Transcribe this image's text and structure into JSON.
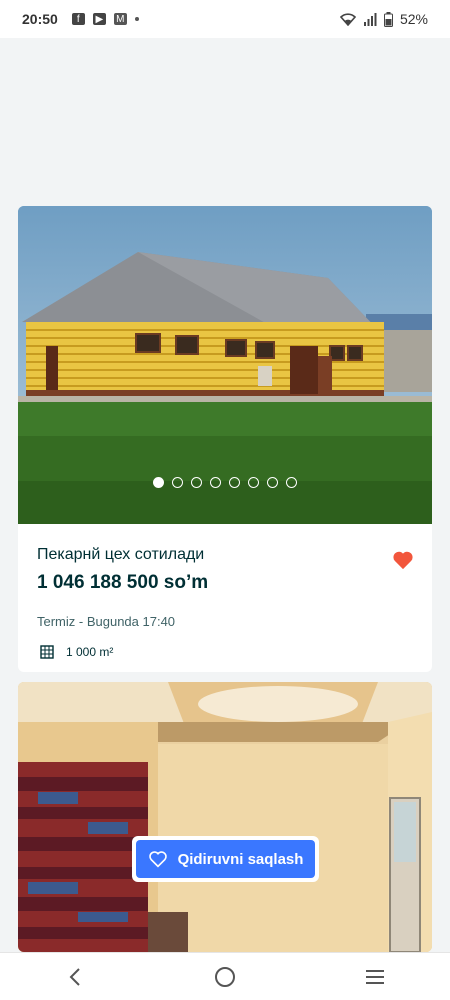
{
  "status_bar": {
    "time": "20:50",
    "battery": "52%",
    "apps": [
      "facebook-icon",
      "youtube-icon",
      "gmail-icon"
    ]
  },
  "listings": [
    {
      "title": "Пекарнй цех сотилади",
      "price": "1 046 188 500 so’m",
      "location": "Termiz - Bugunda 17:40",
      "area": "1 000 m²",
      "favorite": true,
      "photo_count": 8,
      "active_photo": 1
    }
  ],
  "save_search": {
    "label": "Qidiruvni saqlash"
  },
  "colors": {
    "accent": "#3a77ff",
    "heart": "#f2563c",
    "text": "#002f34"
  }
}
